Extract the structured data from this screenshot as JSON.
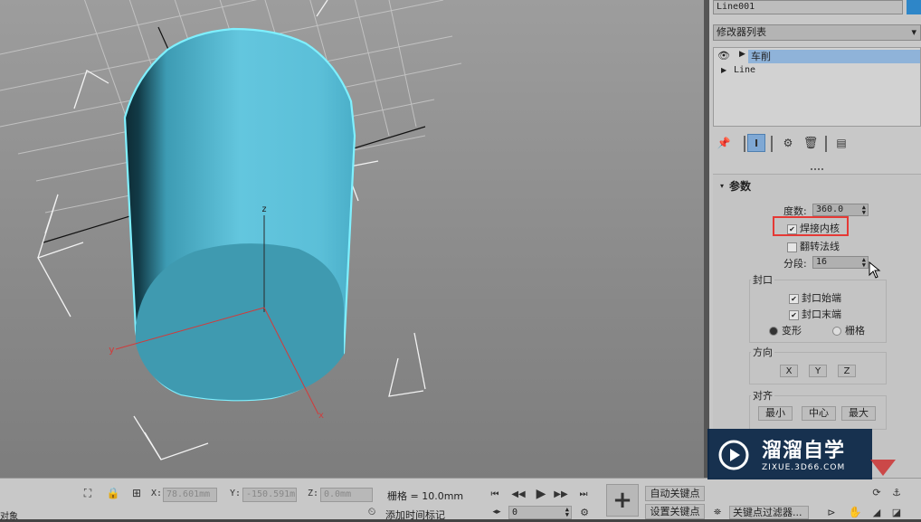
{
  "panel": {
    "object_name": "Line001",
    "modifier_list_label": "修改器列表",
    "stack": [
      {
        "label": "车削",
        "selected": true
      },
      {
        "label": "Line",
        "selected": false
      }
    ],
    "rollout_title": "参数",
    "degrees_label": "度数:",
    "degrees_value": "360.0",
    "weld_core_label": "焊接内核",
    "flip_normals_label": "翻转法线",
    "segments_label": "分段:",
    "segments_value": "16",
    "capping_label": "封口",
    "cap_start_label": "封口始端",
    "cap_end_label": "封口末端",
    "morph_label": "变形",
    "grid_label": "栅格",
    "direction_label": "方向",
    "dir_x": "X",
    "dir_y": "Y",
    "dir_z": "Z",
    "align_label": "对齐",
    "align_min": "最小",
    "align_center": "中心",
    "align_max": "最大"
  },
  "viewport": {
    "axis_x": "x",
    "axis_y": "y",
    "axis_z": "z"
  },
  "status": {
    "left_text": "对象",
    "x_label": "X:",
    "x_value": "78.601mm",
    "y_label": "Y:",
    "y_value": "-150.591m",
    "z_label": "Z:",
    "z_value": "0.0mm",
    "grid_text": "栅格 = 10.0mm",
    "auto_key": "自动关键点",
    "set_key": "设置关键点",
    "key_filters": "关键点过滤器...",
    "add_time_tag": "添加时间标记",
    "frame_value": "0"
  },
  "watermark": {
    "title": "溜溜自学",
    "url": "ZIXUE.3D66.COM"
  },
  "colors": {
    "selection_highlight": "#e53935",
    "object_cyan": "#5cc3dc",
    "panel_bg": "#c8c8c8",
    "stack_selected": "#8fb3d9"
  }
}
